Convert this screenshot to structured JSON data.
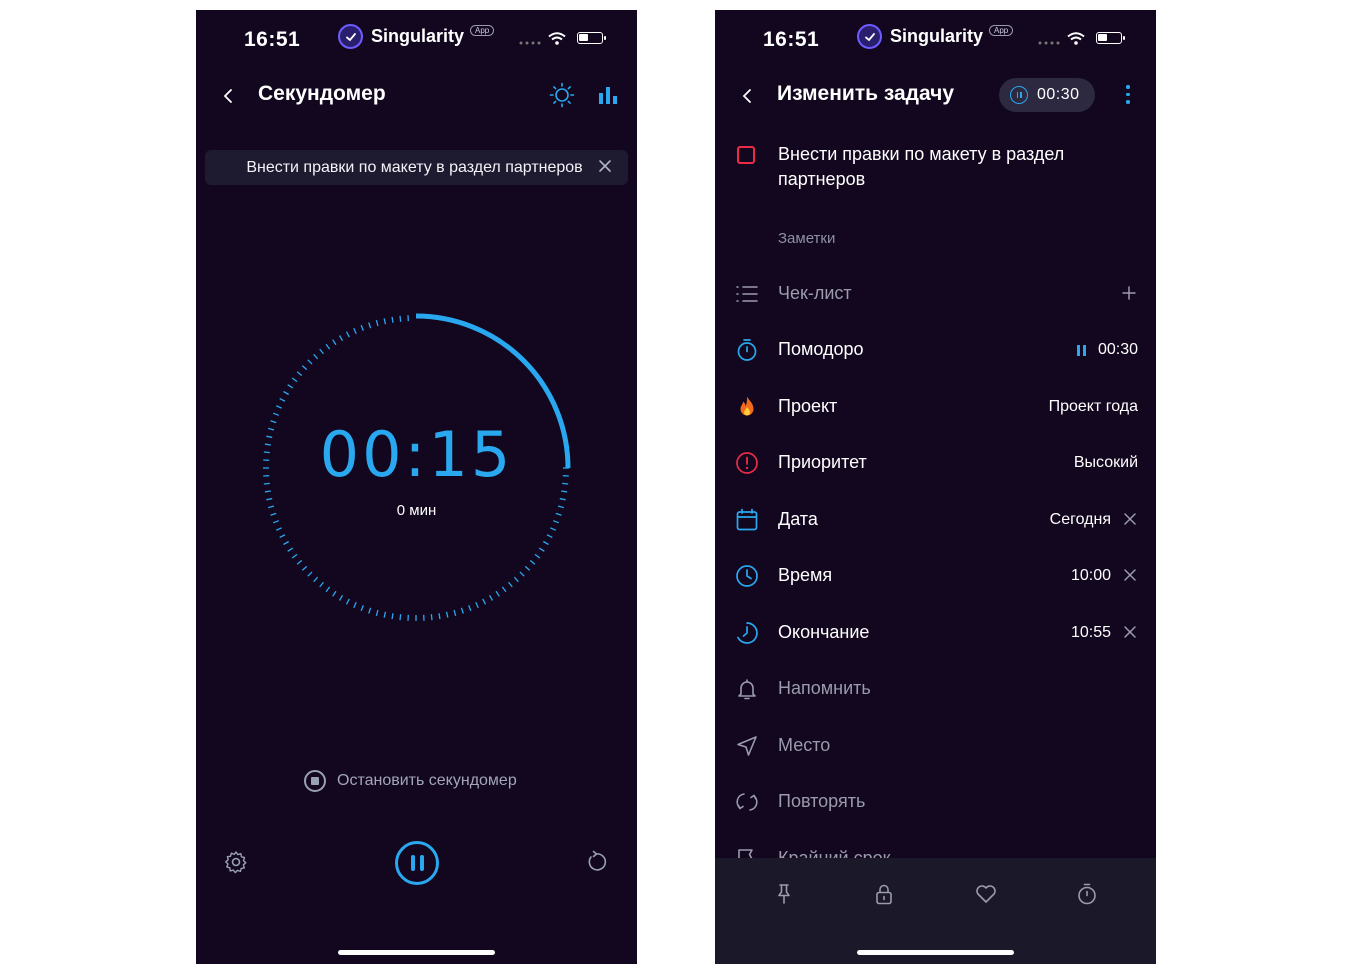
{
  "status_bar": {
    "time": "16:51",
    "app_name": "Singularity",
    "app_badge": "App"
  },
  "left_screen": {
    "title": "Секундомер",
    "task_banner": "Внести правки по макету в раздел партнеров",
    "timer": {
      "display": "00:15",
      "subtitle": "0 мин",
      "progress_fraction": 0.25
    },
    "stop_label": "Остановить секундомер",
    "icons": [
      "back-icon",
      "brightness-icon",
      "stats-icon",
      "close-icon",
      "stop-icon",
      "settings-icon",
      "pause-icon",
      "reset-icon"
    ]
  },
  "right_screen": {
    "title": "Изменить задачу",
    "timer_pill": "00:30",
    "task_name": "Внести правки по макету в раздел партнеров",
    "notes_placeholder": "Заметки",
    "rows": {
      "checklist": {
        "label": "Чек-лист"
      },
      "pomodoro": {
        "label": "Помодоро",
        "value": "00:30"
      },
      "project": {
        "label": "Проект",
        "value": "Проект года"
      },
      "priority": {
        "label": "Приоритет",
        "value": "Высокий"
      },
      "date": {
        "label": "Дата",
        "value": "Сегодня"
      },
      "time": {
        "label": "Время",
        "value": "10:00"
      },
      "end": {
        "label": "Окончание",
        "value": "10:55"
      },
      "remind": {
        "label": "Напомнить"
      },
      "place": {
        "label": "Место"
      },
      "repeat": {
        "label": "Повторять"
      },
      "deadline": {
        "label": "Крайний срок"
      }
    },
    "bottom_icons": [
      "pin-icon",
      "lock-icon",
      "heart-icon",
      "stopwatch-icon"
    ]
  },
  "colors": {
    "background": "#12071f",
    "accent": "#29a8ef",
    "priority_red": "#ec2b47",
    "muted": "#9a9bab"
  }
}
